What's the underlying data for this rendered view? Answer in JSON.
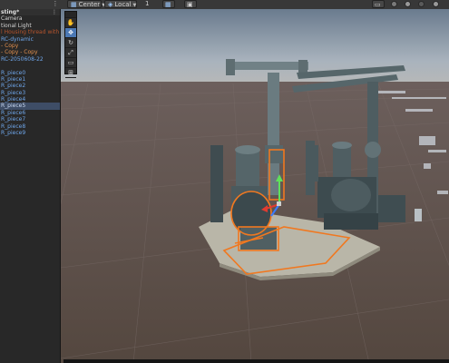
{
  "toolbar": {
    "pivot_label": "Center",
    "space_label": "Local",
    "snap_value": "1",
    "menu_dots": "⋮"
  },
  "hierarchy": {
    "scene_name": "sting*",
    "rows": [
      {
        "label": "Camera",
        "style": "white"
      },
      {
        "label": "tional Light",
        "style": "white"
      },
      {
        "label": "l Housing thread with gr",
        "style": "prefab"
      },
      {
        "label": "RC-dynamic",
        "style": "blue"
      },
      {
        "label": "- Copy",
        "style": "orange"
      },
      {
        "label": "- Copy - Copy",
        "style": "orange"
      },
      {
        "label": "RC-2050608-22",
        "style": "blue"
      },
      {
        "label": "",
        "style": "blue"
      },
      {
        "label": "R_piece0",
        "style": "blue"
      },
      {
        "label": "R_piece1",
        "style": "blue"
      },
      {
        "label": "R_piece2",
        "style": "blue"
      },
      {
        "label": "R_piece3",
        "style": "blue"
      },
      {
        "label": "R_piece4",
        "style": "blue"
      },
      {
        "label": "R_piece5",
        "style": "sel"
      },
      {
        "label": "R_piece6",
        "style": "blue"
      },
      {
        "label": "R_piece7",
        "style": "blue"
      },
      {
        "label": "R_piece8",
        "style": "blue"
      },
      {
        "label": "R_piece9",
        "style": "blue"
      }
    ]
  },
  "scene_tools": [
    "hand-tool",
    "move-tool",
    "rotate-tool",
    "scale-tool",
    "rect-tool",
    "transform-tool"
  ],
  "colors": {
    "selection_outline": "#f07820",
    "gizmo_y": "#5fe05a",
    "gizmo_x": "#e03b30",
    "gizmo_z": "#3a7bff",
    "sky_top": "#6e7f92",
    "floor": "#5e4f4c"
  }
}
